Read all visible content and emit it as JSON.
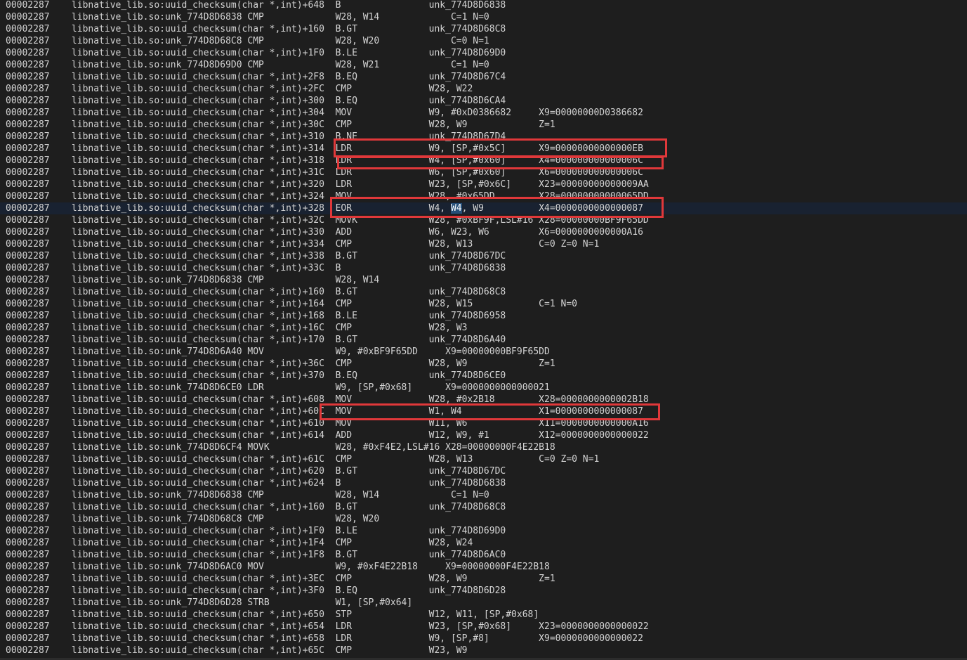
{
  "trace": {
    "lines": [
      "00002287    libnative_lib.so:uuid_checksum(char *,int)+648  B                unk_774D8D6838",
      "00002287    libnative_lib.so:unk_774D8D6838 CMP             W28, W14             C=1 N=0",
      "00002287    libnative_lib.so:uuid_checksum(char *,int)+160  B.GT             unk_774D8D68C8",
      "00002287    libnative_lib.so:unk_774D8D68C8 CMP             W28, W20             C=0 N=1",
      "00002287    libnative_lib.so:uuid_checksum(char *,int)+1F0  B.LE             unk_774D8D69D0",
      "00002287    libnative_lib.so:unk_774D8D69D0 CMP             W28, W21             C=1 N=0",
      "00002287    libnative_lib.so:uuid_checksum(char *,int)+2F8  B.EQ             unk_774D8D67C4",
      "00002287    libnative_lib.so:uuid_checksum(char *,int)+2FC  CMP              W28, W22",
      "00002287    libnative_lib.so:uuid_checksum(char *,int)+300  B.EQ             unk_774D8D6CA4",
      "00002287    libnative_lib.so:uuid_checksum(char *,int)+304  MOV              W9, #0xD0386682     X9=00000000D0386682",
      "00002287    libnative_lib.so:uuid_checksum(char *,int)+30C  CMP              W28, W9             Z=1",
      "00002287    libnative_lib.so:uuid_checksum(char *,int)+310  B.NE             unk_774D8D67D4",
      "00002287    libnative_lib.so:uuid_checksum(char *,int)+314  LDR              W9, [SP,#0x5C]      X9=00000000000000EB",
      "00002287    libnative_lib.so:uuid_checksum(char *,int)+318  LDR              W4, [SP,#0x60]      X4=000000000000006C",
      "00002287    libnative_lib.so:uuid_checksum(char *,int)+31C  LDR              W6, [SP,#0x60]      X6=000000000000006C",
      "00002287    libnative_lib.so:uuid_checksum(char *,int)+320  LDR              W23, [SP,#0x6C]     X23=00000000000009AA",
      "00002287    libnative_lib.so:uuid_checksum(char *,int)+324  MOV              W28, #0x65DD        X28=00000000000065DD",
      "00002287    libnative_lib.so:uuid_checksum(char *,int)+328  EOR              W4, W4, W9          X4=0000000000000087",
      "00002287    libnative_lib.so:uuid_checksum(char *,int)+32C  MOVK             W28, #0xBF9F,LSL#16 X28=00000000BF9F65DD",
      "00002287    libnative_lib.so:uuid_checksum(char *,int)+330  ADD              W6, W23, W6         X6=0000000000000A16",
      "00002287    libnative_lib.so:uuid_checksum(char *,int)+334  CMP              W28, W13            C=0 Z=0 N=1",
      "00002287    libnative_lib.so:uuid_checksum(char *,int)+338  B.GT             unk_774D8D67DC",
      "00002287    libnative_lib.so:uuid_checksum(char *,int)+33C  B                unk_774D8D6838",
      "00002287    libnative_lib.so:unk_774D8D6838 CMP             W28, W14",
      "00002287    libnative_lib.so:uuid_checksum(char *,int)+160  B.GT             unk_774D8D68C8",
      "00002287    libnative_lib.so:uuid_checksum(char *,int)+164  CMP              W28, W15            C=1 N=0",
      "00002287    libnative_lib.so:uuid_checksum(char *,int)+168  B.LE             unk_774D8D6958",
      "00002287    libnative_lib.so:uuid_checksum(char *,int)+16C  CMP              W28, W3",
      "00002287    libnative_lib.so:uuid_checksum(char *,int)+170  B.GT             unk_774D8D6A40",
      "00002287    libnative_lib.so:unk_774D8D6A40 MOV             W9, #0xBF9F65DD     X9=00000000BF9F65DD",
      "00002287    libnative_lib.so:uuid_checksum(char *,int)+36C  CMP              W28, W9             Z=1",
      "00002287    libnative_lib.so:uuid_checksum(char *,int)+370  B.EQ             unk_774D8D6CE0",
      "00002287    libnative_lib.so:unk_774D8D6CE0 LDR             W9, [SP,#0x68]      X9=0000000000000021",
      "00002287    libnative_lib.so:uuid_checksum(char *,int)+608  MOV              W28, #0x2B18        X28=0000000000002B18",
      "00002287    libnative_lib.so:uuid_checksum(char *,int)+60C  MOV              W1, W4              X1=0000000000000087",
      "00002287    libnative_lib.so:uuid_checksum(char *,int)+610  MOV              W11, W6             X11=0000000000000A16",
      "00002287    libnative_lib.so:uuid_checksum(char *,int)+614  ADD              W12, W9, #1         X12=0000000000000022",
      "00002287    libnative_lib.so:unk_774D8D6CF4 MOVK            W28, #0xF4E2,LSL#16 X28=00000000F4E22B18",
      "00002287    libnative_lib.so:uuid_checksum(char *,int)+61C  CMP              W28, W13            C=0 Z=0 N=1",
      "00002287    libnative_lib.so:uuid_checksum(char *,int)+620  B.GT             unk_774D8D67DC",
      "00002287    libnative_lib.so:uuid_checksum(char *,int)+624  B                unk_774D8D6838",
      "00002287    libnative_lib.so:unk_774D8D6838 CMP             W28, W14             C=1 N=0",
      "00002287    libnative_lib.so:uuid_checksum(char *,int)+160  B.GT             unk_774D8D68C8",
      "00002287    libnative_lib.so:unk_774D8D68C8 CMP             W28, W20",
      "00002287    libnative_lib.so:uuid_checksum(char *,int)+1F0  B.LE             unk_774D8D69D0",
      "00002287    libnative_lib.so:uuid_checksum(char *,int)+1F4  CMP              W28, W24",
      "00002287    libnative_lib.so:uuid_checksum(char *,int)+1F8  B.GT             unk_774D8D6AC0",
      "00002287    libnative_lib.so:unk_774D8D6AC0 MOV             W9, #0xF4E22B18     X9=00000000F4E22B18",
      "00002287    libnative_lib.so:uuid_checksum(char *,int)+3EC  CMP              W28, W9             Z=1",
      "00002287    libnative_lib.so:uuid_checksum(char *,int)+3F0  B.EQ             unk_774D8D6D28",
      "00002287    libnative_lib.so:unk_774D8D6D28 STRB            W1, [SP,#0x64]",
      "00002287    libnative_lib.so:uuid_checksum(char *,int)+650  STP              W12, W11, [SP,#0x68]",
      "00002287    libnative_lib.so:uuid_checksum(char *,int)+654  LDR              W23, [SP,#0x68]     X23=0000000000000022",
      "00002287    libnative_lib.so:uuid_checksum(char *,int)+658  LDR              W9, [SP,#8]         X9=0000000000000022",
      "00002287    libnative_lib.so:uuid_checksum(char *,int)+65C  CMP              W23, W9"
    ],
    "current_line_index": 17,
    "selection": {
      "line_index": 17,
      "text": "W4",
      "occurrence": 2
    }
  },
  "colors": {
    "background": "#1e1e1e",
    "text": "#d4d4d4",
    "current_line": "#192231",
    "selection": "#264f78",
    "annotation": "#e0383a"
  }
}
